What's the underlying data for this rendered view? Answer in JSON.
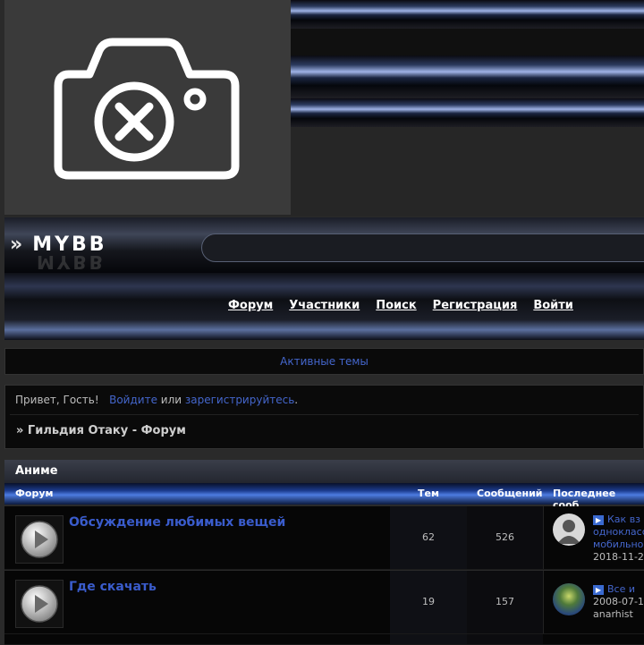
{
  "header": {
    "logo_text": "MYBB"
  },
  "nav": {
    "items": [
      "Форум",
      "Участники",
      "Поиск",
      "Регистрация",
      "Войти"
    ]
  },
  "active_topics": "Активные темы",
  "welcome": {
    "greeting": "Привет, Гость!",
    "login": "Войдите",
    "or": "или",
    "register": "зарегистрируйтесь",
    "dot": "."
  },
  "breadcrumb": "» Гильдия Отаку - Форум",
  "category": "Аниме",
  "columns": {
    "forum": "Форум",
    "topics": "Тем",
    "posts": "Сообщений",
    "last_post": "Последнее сооб"
  },
  "forums": [
    {
      "title": "Обсуждение любимых вещей",
      "topics": "62",
      "posts": "526",
      "last_post": {
        "line1": "Как вз",
        "line2": "однокласс",
        "line3": "мобильно",
        "date": "2018-11-2"
      }
    },
    {
      "title": "Где скачать",
      "topics": "19",
      "posts": "157",
      "last_post": {
        "line1": "Все и",
        "date": "2008-07-1",
        "author": "anarhist"
      }
    }
  ]
}
